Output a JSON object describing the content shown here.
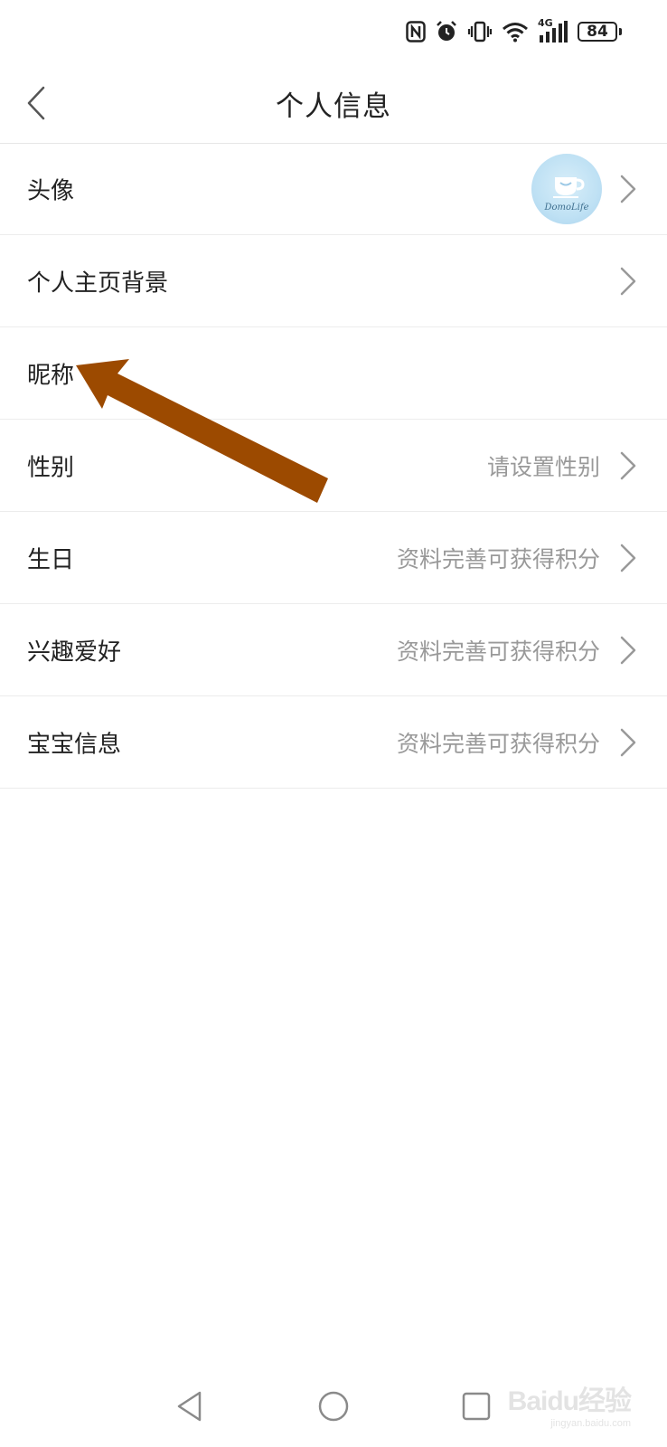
{
  "status_bar": {
    "icons": [
      "nfc-icon",
      "alarm-icon",
      "vibrate-icon",
      "wifi-icon",
      "signal-4g-icon",
      "battery-icon"
    ],
    "network_label": "4G",
    "battery_level": "84"
  },
  "header": {
    "back_icon": "chevron-left-icon",
    "title": "个人信息"
  },
  "rows": [
    {
      "label": "头像",
      "value": "",
      "avatar_text": "DomoLife"
    },
    {
      "label": "个人主页背景",
      "value": ""
    },
    {
      "label": "昵称",
      "value": ""
    },
    {
      "label": "性别",
      "value": "请设置性别"
    },
    {
      "label": "生日",
      "value": "资料完善可获得积分"
    },
    {
      "label": "兴趣爱好",
      "value": "资料完善可获得积分"
    },
    {
      "label": "宝宝信息",
      "value": "资料完善可获得积分"
    }
  ],
  "annotation": {
    "color": "#9c4a00"
  },
  "nav_bar": {
    "icons": [
      "back-triangle-icon",
      "home-circle-icon",
      "recents-square-icon"
    ]
  },
  "watermark": {
    "logo": "Baidu经验",
    "sub": "jingyan.baidu.com"
  }
}
